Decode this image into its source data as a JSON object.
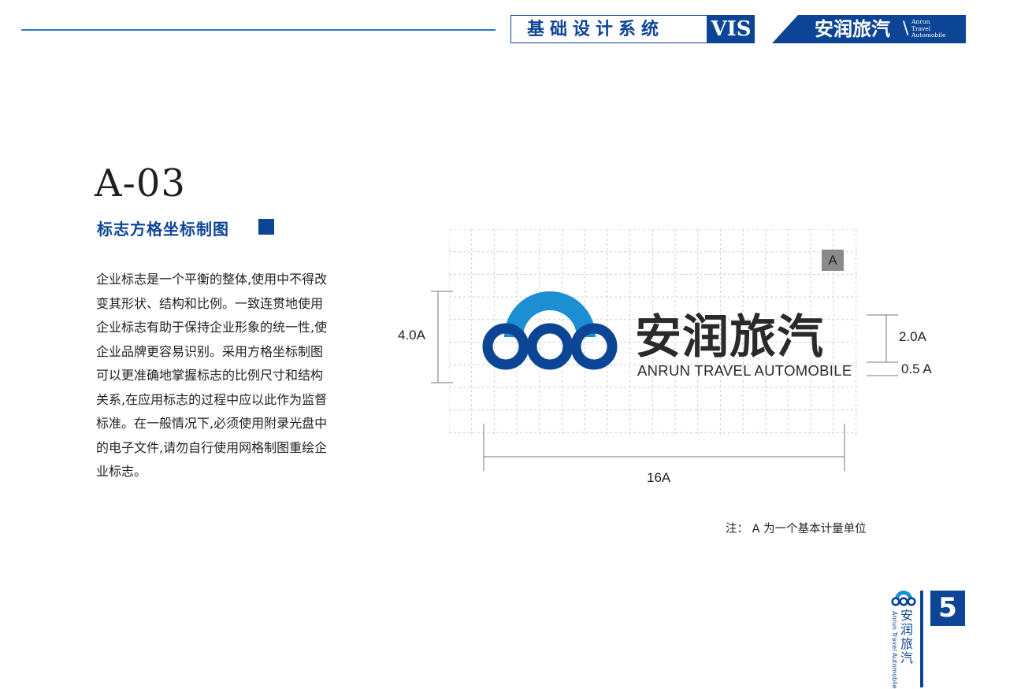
{
  "header": {
    "title": "基础设计系统",
    "vis": "VIS",
    "brand_cn": "安润旅汽",
    "brand_en": [
      "Anrun",
      "Travel",
      "Automobile"
    ]
  },
  "section": {
    "code": "A-03",
    "subtitle": "标志方格坐标制图"
  },
  "body": {
    "lines": [
      "企业标志是一个平衡的整体,使用中不得改",
      "变其形状、结构和比例。一致连贯地使用",
      "企业标志有助于保持企业形象的统一性,使",
      "企业品牌更容易识别。采用方格坐标制图",
      "可以更准确地掌握标志的比例尺寸和结构",
      "关系,在应用标志的过程中应以此作为监督",
      "标准。在一般情况下,必须使用附录光盘中",
      "的电子文件,请勿自行使用网格制图重绘企",
      "业标志。"
    ]
  },
  "diagram": {
    "unit_badge": "A",
    "logo_cn": "安润旅汽",
    "logo_en": "ANRUN TRAVEL AUTOMOBILE",
    "dim_height": "4.0A",
    "dim_text_height": "2.0A",
    "dim_en_height": "0.5 A",
    "dim_width": "16A",
    "note": "注： A 为一个基本计量单位"
  },
  "footer": {
    "brand_cn": "安润旅汽",
    "brand_en": "Anrun Travel Automobile",
    "page": "5"
  },
  "colors": {
    "brand_blue": "#0d4596",
    "light_blue": "#1b8fd2",
    "rule_blue": "#2b7bc0",
    "grid": "#d0d0d0"
  }
}
